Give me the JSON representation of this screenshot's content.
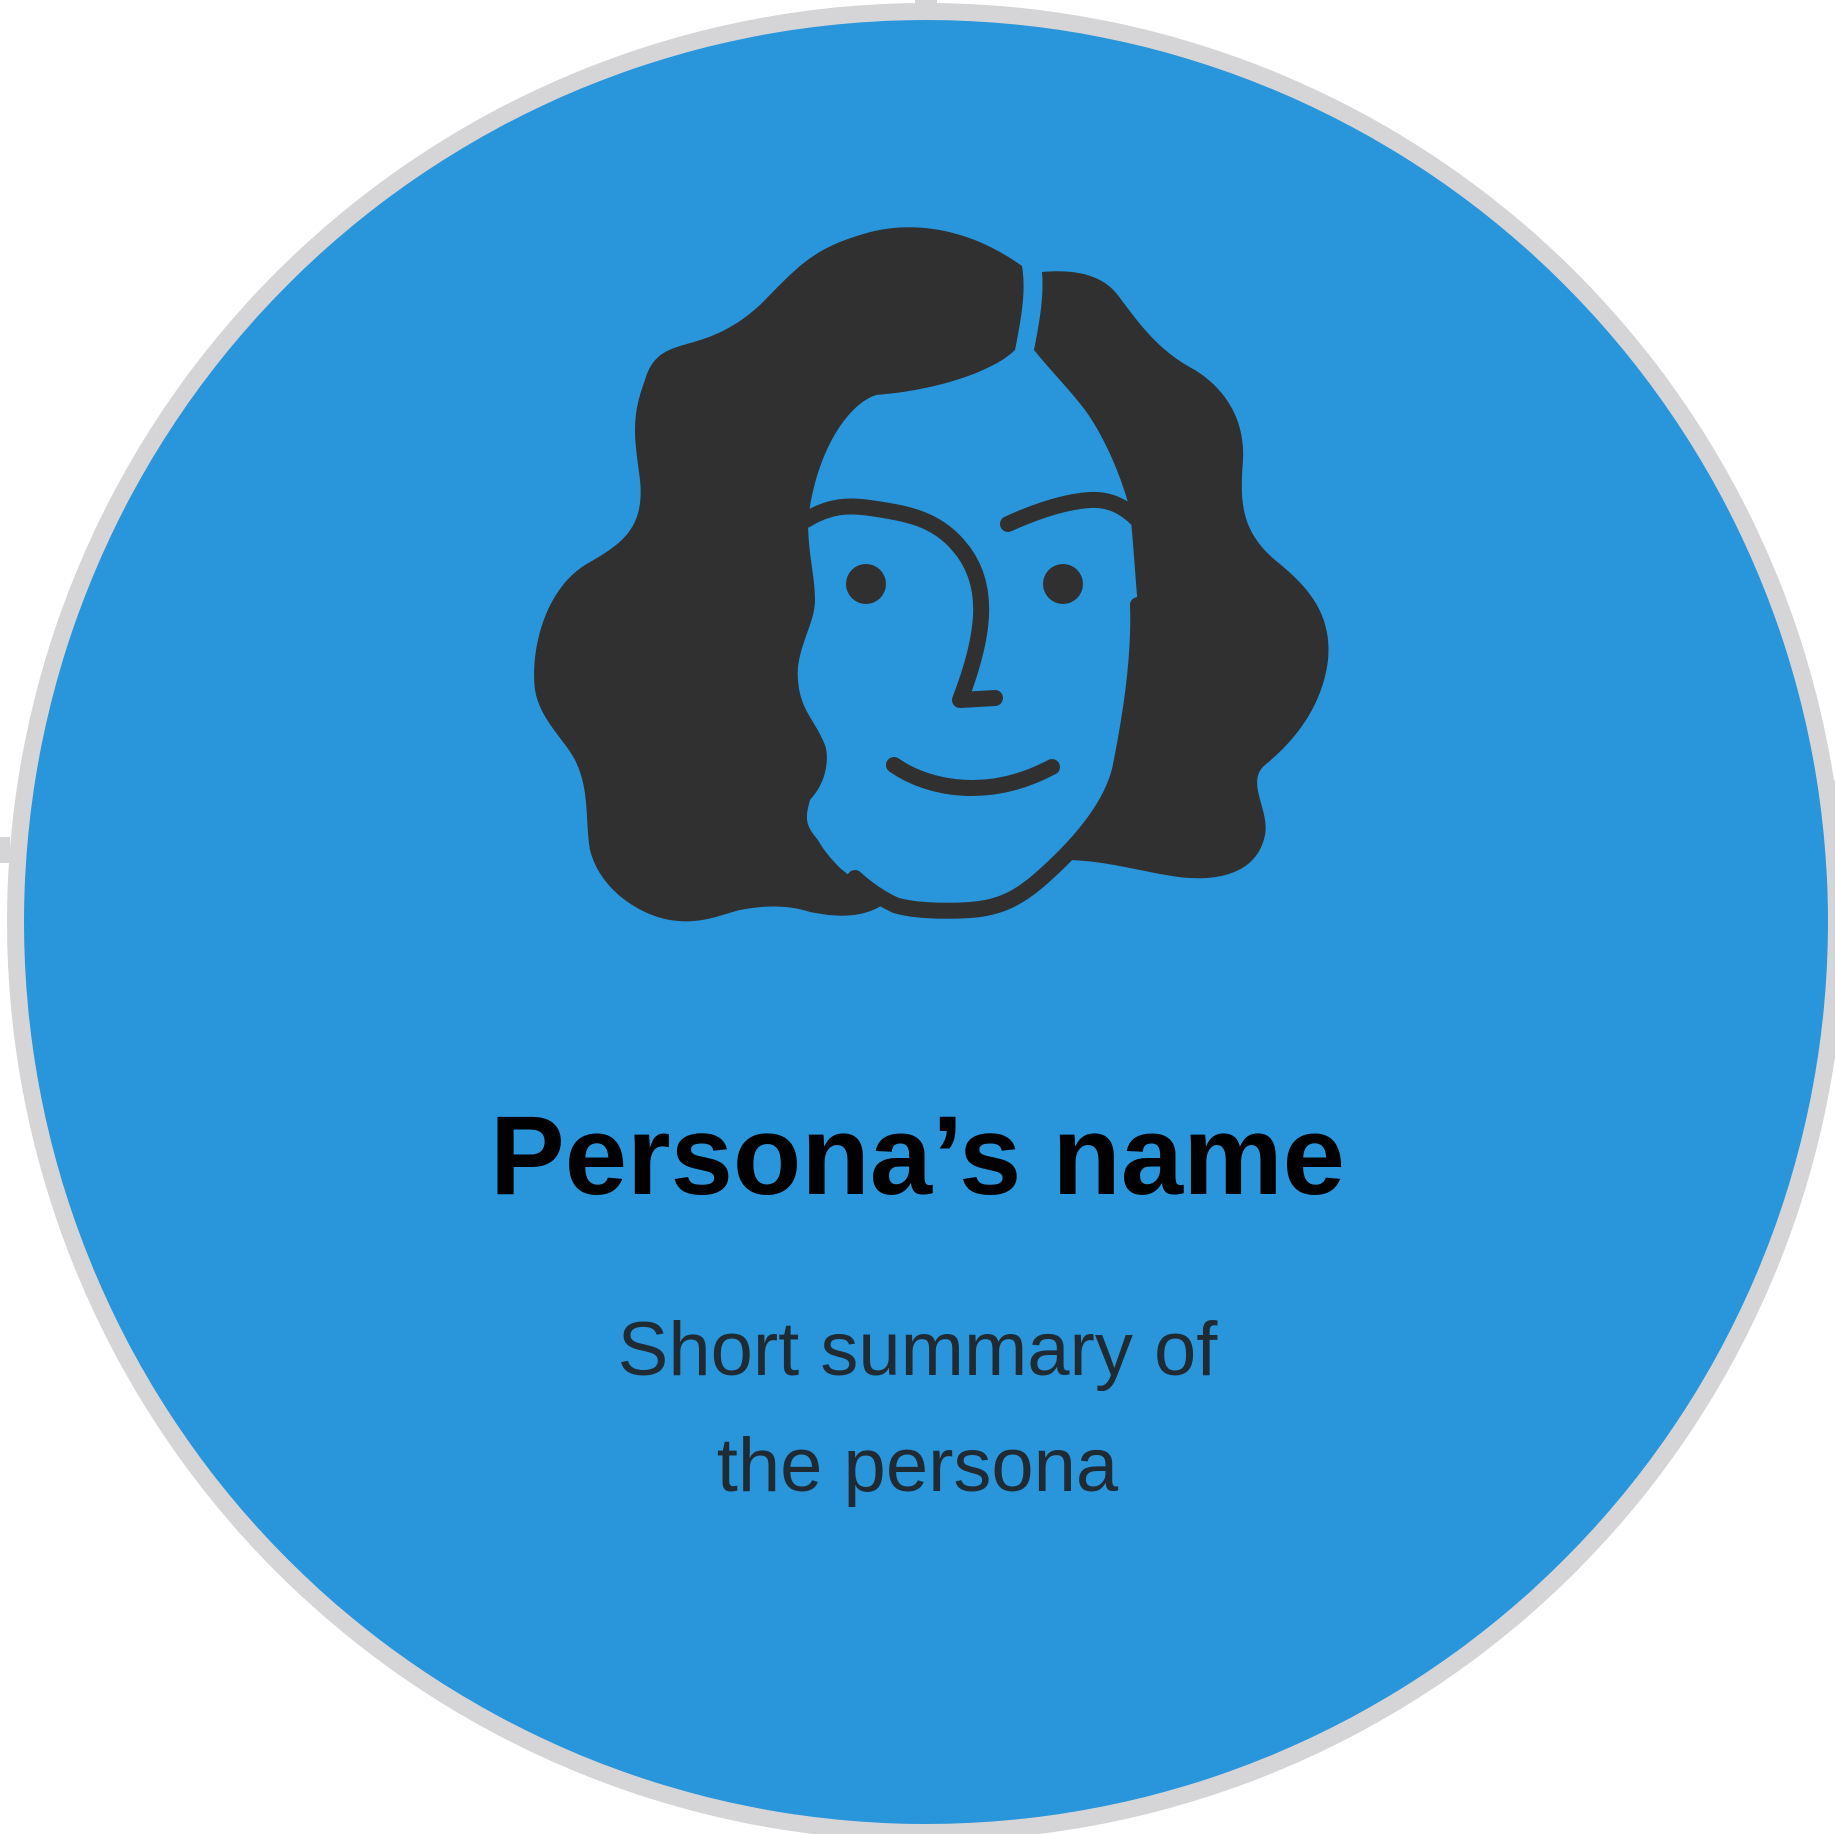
{
  "card": {
    "fill_color": "#2995db",
    "border_color": "#d5d5d7",
    "line_color": "#303030",
    "icon": "persona-avatar-icon"
  },
  "persona": {
    "name": "Persona’s name",
    "summary_line_1": "Short summary of",
    "summary_line_2": "the persona"
  }
}
